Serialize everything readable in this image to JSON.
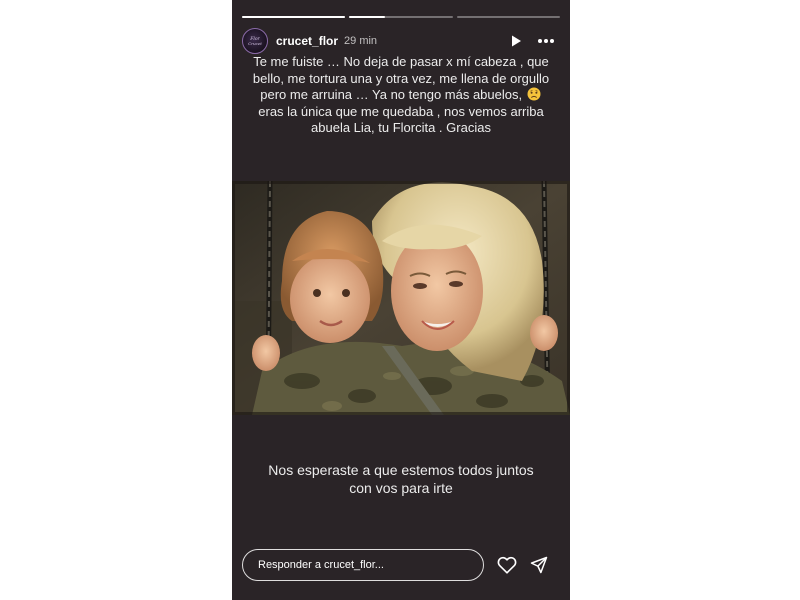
{
  "story": {
    "username": "crucet_flor",
    "timestamp": "29 min",
    "avatar_text": "Flor Crucet",
    "progress": [
      1.0,
      0.35,
      0.0
    ],
    "caption_top_1": "Te me fuiste … No deja de pasar x mí cabeza , que bello, me tortura una y otra vez, me llena de orgullo pero me arruina … Ya no tengo más abuelos,",
    "caption_top_emoji": "sad-face-emoji",
    "caption_top_2": " eras la única que me quedaba , nos vemos arriba abuela Lia, tu Florcita . Gracias",
    "caption_bottom": "Nos esperaste a que estemos todos juntos con vos para irte",
    "reply_placeholder": "Responder a crucet_flor...",
    "icons": {
      "play": "play-icon",
      "more": "more-horizontal-icon",
      "like": "heart-outline-icon",
      "send": "send-paper-plane-icon"
    },
    "colors": {
      "background": "#2a2427",
      "text": "#ececec",
      "accent_ring": "#8a6aa8"
    }
  }
}
